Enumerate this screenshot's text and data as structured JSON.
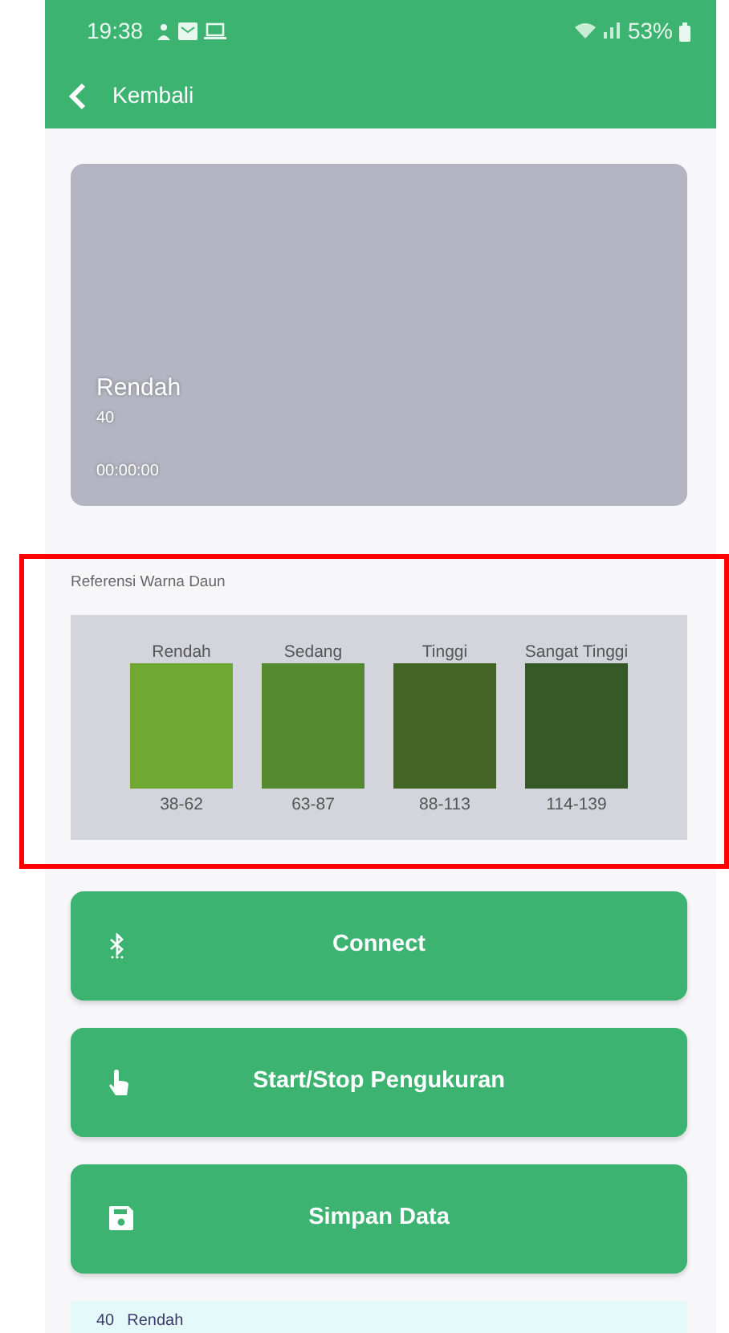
{
  "status_bar": {
    "time": "19:38",
    "battery": "53%"
  },
  "app_bar": {
    "back_label": "Kembali"
  },
  "preview": {
    "category": "Rendah",
    "value": "40",
    "timer": "00:00:00"
  },
  "reference": {
    "title": "Referensi Warna Daun",
    "swatches": [
      {
        "label": "Rendah",
        "range": "38-62",
        "color": "#6fa832"
      },
      {
        "label": "Sedang",
        "range": "63-87",
        "color": "#558a31"
      },
      {
        "label": "Tinggi",
        "range": "88-113",
        "color": "#436626"
      },
      {
        "label": "Sangat Tinggi",
        "range": "114-139",
        "color": "#355a27"
      }
    ]
  },
  "buttons": [
    {
      "label": "Connect",
      "kind": "bluetooth"
    },
    {
      "label": "Start/Stop Pengukuran",
      "kind": "touch"
    },
    {
      "label": "Simpan Data",
      "kind": "save"
    }
  ],
  "log": [
    {
      "value": "40",
      "category": "Rendah"
    }
  ],
  "highlight_frame": true
}
